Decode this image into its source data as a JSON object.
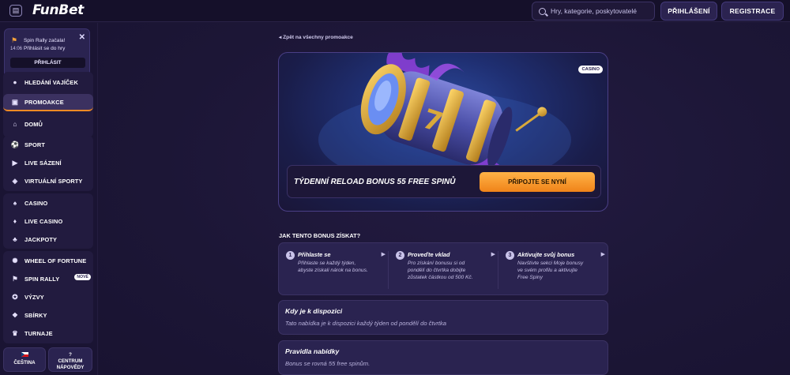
{
  "header": {
    "logo": "FunBet",
    "search_placeholder": "Hry, kategorie, poskytovatelé",
    "login_label": "PŘIHLÁŠENÍ",
    "register_label": "REGISTRACE"
  },
  "notification": {
    "text": "Spin Rally začala! Přihlásit se do hry",
    "time": "14:06",
    "button_label": "PŘIHLÁSIT"
  },
  "sidebar": {
    "group1": [
      {
        "label": "HLEDÁNÍ VAJÍČEK",
        "icon": "egg-icon"
      },
      {
        "label": "PROMOAKCE",
        "icon": "gift-icon",
        "active": true
      },
      {
        "label": "DOMŮ",
        "icon": "home-icon"
      }
    ],
    "group2": [
      {
        "label": "SPORT",
        "icon": "ball-icon"
      },
      {
        "label": "LIVE SÁZENÍ",
        "icon": "live-icon"
      },
      {
        "label": "VIRTUÁLNÍ SPORTY",
        "icon": "gamepad-icon"
      }
    ],
    "group3": [
      {
        "label": "CASINO",
        "icon": "cards-icon"
      },
      {
        "label": "LIVE CASINO",
        "icon": "dealer-icon"
      },
      {
        "label": "JACKPOTY",
        "icon": "clover-icon"
      }
    ],
    "group4": [
      {
        "label": "WHEEL OF FORTUNE",
        "icon": "wheel-icon"
      },
      {
        "label": "SPIN RALLY",
        "icon": "flag-icon",
        "badge": "NOVÉ"
      },
      {
        "label": "VÝZVY",
        "icon": "medal-icon"
      },
      {
        "label": "SBÍRKY",
        "icon": "collection-icon"
      },
      {
        "label": "TURNAJE",
        "icon": "trophy-icon"
      }
    ],
    "language_label": "ČEŠTINA",
    "help_label": "CENTRUM NÁPOVĚDY"
  },
  "main": {
    "back_link": "Zpět na všechny promoakce",
    "hero_tag": "CASINO",
    "promo_title": "TÝDENNÍ RELOAD BONUS 55 FREE SPINŮ",
    "join_label": "PŘIPOJTE SE NYNÍ",
    "how_title": "JAK TENTO BONUS ZÍSKAT?",
    "steps": [
      {
        "num": "1",
        "title": "Přihlaste se",
        "text": "Přihlaste se každý týden, abyste získali nárok na bonus."
      },
      {
        "num": "2",
        "title": "Proveďte vklad",
        "text": "Pro získání bonusu si od pondělí do čtvrtka dobijte zůstatek částkou od 500 Kč."
      },
      {
        "num": "3",
        "title": "Aktivujte svůj bonus",
        "text": "Navštivte sekci Moje bonusy ve svém profilu a aktivujte Free Spiny"
      }
    ],
    "availability": {
      "title": "Kdy je k dispozici",
      "text": "Tato nabídka je k dispozici každý týden od pondělí do čtvrtka"
    },
    "rules": {
      "title": "Pravidla nabídky",
      "text": "Bonus se rovná 55 free spinům."
    }
  },
  "colors": {
    "accent_orange": "#f08319",
    "background": "#1b1533",
    "panel": "#2a2350"
  }
}
